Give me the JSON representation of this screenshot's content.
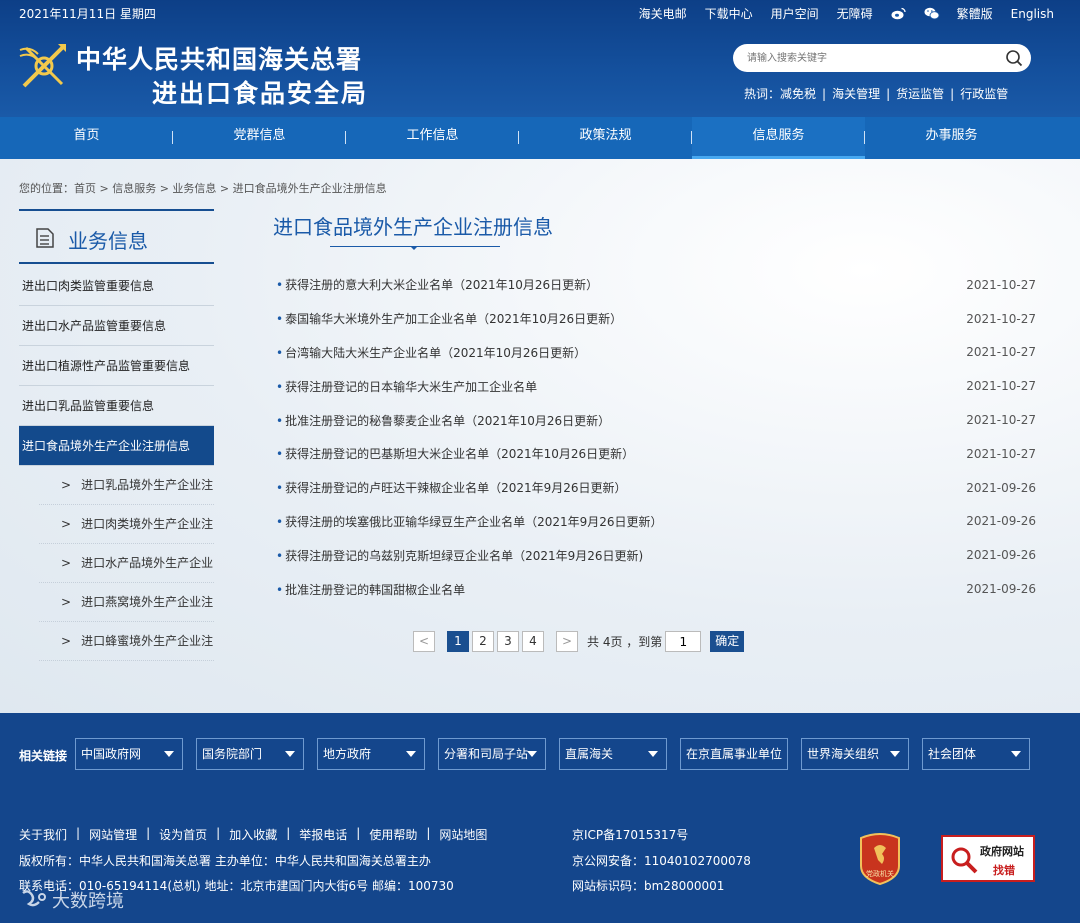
{
  "header": {
    "date": "2021年11月11日 星期四",
    "top_links": [
      "海关电邮",
      "下载中心",
      "用户空间",
      "无障碍",
      "繁體版",
      "English"
    ],
    "org_line1": "中华人民共和国海关总署",
    "org_line2": "进出口食品安全局",
    "search_placeholder": "请输入搜索关键字",
    "hot_label": "热词：",
    "hot_words": [
      "减免税",
      "海关管理",
      "货运监管",
      "行政监管"
    ]
  },
  "nav": {
    "items": [
      "首页",
      "党群信息",
      "工作信息",
      "政策法规",
      "信息服务",
      "办事服务"
    ],
    "active_index": 4
  },
  "breadcrumb": "您的位置：首页 > 信息服务 > 业务信息 > 进口食品境外生产企业注册信息",
  "sidebar": {
    "title": "业务信息",
    "items": [
      "进出口肉类监管重要信息",
      "进出口水产品监管重要信息",
      "进出口植源性产品监管重要信息",
      "进出口乳品监管重要信息",
      "进口食品境外生产企业注册信息"
    ],
    "sub_items": [
      "进口乳品境外生产企业注...",
      "进口肉类境外生产企业注...",
      "进口水产品境外生产企业...",
      "进口燕窝境外生产企业注...",
      "进口蜂蜜境外生产企业注..."
    ]
  },
  "content": {
    "title": "进口食品境外生产企业注册信息",
    "rows": [
      {
        "text": "获得注册的意大利大米企业名单（2021年10月26日更新）",
        "date": "2021-10-27"
      },
      {
        "text": "泰国输华大米境外生产加工企业名单（2021年10月26日更新）",
        "date": "2021-10-27"
      },
      {
        "text": "台湾输大陆大米生产企业名单（2021年10月26日更新）",
        "date": "2021-10-27"
      },
      {
        "text": "获得注册登记的日本输华大米生产加工企业名单",
        "date": "2021-10-27"
      },
      {
        "text": "批准注册登记的秘鲁藜麦企业名单（2021年10月26日更新）",
        "date": "2021-10-27"
      },
      {
        "text": "获得注册登记的巴基斯坦大米企业名单（2021年10月26日更新）",
        "date": "2021-10-27"
      },
      {
        "text": "获得注册登记的卢旺达干辣椒企业名单（2021年9月26日更新）",
        "date": "2021-09-26"
      },
      {
        "text": "获得注册的埃塞俄比亚输华绿豆生产企业名单（2021年9月26日更新）",
        "date": "2021-09-26"
      },
      {
        "text": "获得注册登记的乌兹别克斯坦绿豆企业名单（2021年9月26日更新)",
        "date": "2021-09-26"
      },
      {
        "text": "批准注册登记的韩国甜椒企业名单",
        "date": "2021-09-26"
      }
    ]
  },
  "pager": {
    "prev": "<",
    "pages": [
      "1",
      "2",
      "3",
      "4"
    ],
    "current": "1",
    "next": ">",
    "total_text": "共 4页 ，到第",
    "jump_value": "1",
    "confirm": "确定"
  },
  "footer": {
    "related_label": "相关链接",
    "selects": [
      "中国政府网",
      "国务院部门",
      "地方政府",
      "分署和司局子站",
      "直属海关",
      "在京直属事业单位",
      "世界海关组织",
      "社会团体"
    ],
    "links": [
      "关于我们",
      "网站管理",
      "设为首页",
      "加入收藏",
      "举报电话",
      "使用帮助",
      "网站地图"
    ],
    "copyright": "版权所有：中华人民共和国海关总署 主办单位：中华人民共和国海关总署主办",
    "contact": "联系电话：010-65194114(总机) 地址：北京市建国门内大街6号 邮编：100730",
    "icp": "京ICP备17015317号",
    "police": "京公网安备：11040102700078",
    "site_code": "网站标识码：bm28000001",
    "badge_text": "党政机关",
    "gov_line1": "政府网站",
    "gov_line2": "找错"
  },
  "watermark": "大数跨境"
}
